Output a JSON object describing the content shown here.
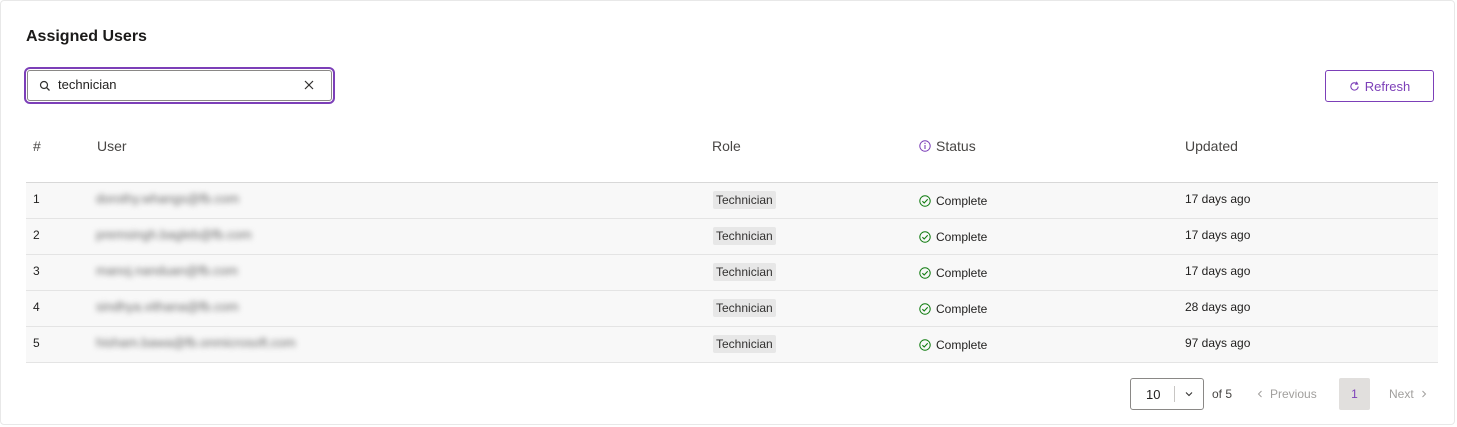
{
  "card": {
    "title": "Assigned Users"
  },
  "search": {
    "value": "technician",
    "placeholder": ""
  },
  "toolbar": {
    "refresh_label": "Refresh"
  },
  "table": {
    "columns": {
      "num": "#",
      "user": "User",
      "role": "Role",
      "status": "Status",
      "updated": "Updated"
    },
    "rows": [
      {
        "num": "1",
        "user": "dorothy.whangs@fb.com",
        "role": "Technician",
        "status": "Complete",
        "updated": "17 days ago"
      },
      {
        "num": "2",
        "user": "premsingh.bagleb@fb.com",
        "role": "Technician",
        "status": "Complete",
        "updated": "17 days ago"
      },
      {
        "num": "3",
        "user": "manoj.nanduan@fb.com",
        "role": "Technician",
        "status": "Complete",
        "updated": "17 days ago"
      },
      {
        "num": "4",
        "user": "sindhya.vithana@fb.com",
        "role": "Technician",
        "status": "Complete",
        "updated": "28 days ago"
      },
      {
        "num": "5",
        "user": "hisham.bawa@fb.onmicrosoft.com",
        "role": "Technician",
        "status": "Complete",
        "updated": "97 days ago"
      }
    ]
  },
  "pagination": {
    "page_size": "10",
    "of_text": "of 5",
    "previous_label": "Previous",
    "current_page": "1",
    "next_label": "Next"
  },
  "colors": {
    "accent": "#7c3fb8",
    "success": "#107c10",
    "row_bg": "#f8f8f8"
  }
}
